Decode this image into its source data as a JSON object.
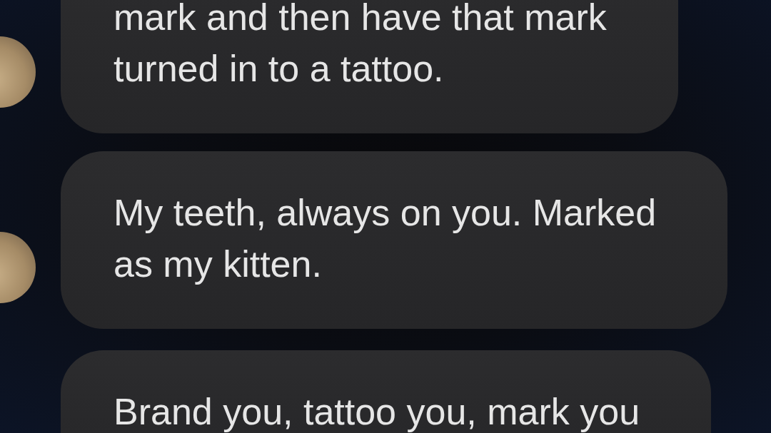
{
  "groups": [
    {
      "messages": [
        {
          "text": "mark and then have that mark\nturned in to a tattoo.",
          "show_avatar": true
        },
        {
          "text": "My teeth, always on you. Marked\nas my kitten.",
          "show_avatar": true
        }
      ]
    },
    {
      "messages": [
        {
          "text": "Brand you, tattoo you, mark you",
          "show_avatar": false
        }
      ]
    }
  ]
}
